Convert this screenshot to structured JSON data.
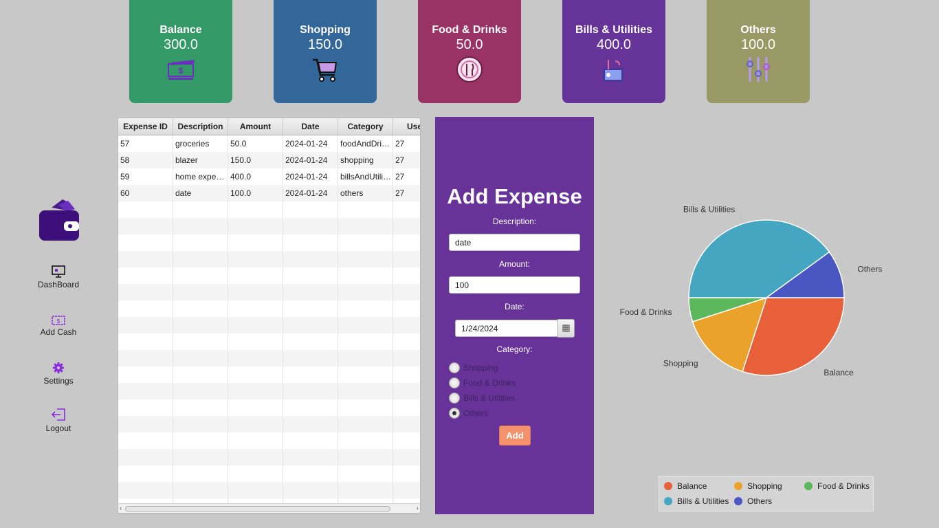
{
  "cards": [
    {
      "title": "Balance",
      "value": "300.0",
      "color": "#339966",
      "icon": "cash-icon"
    },
    {
      "title": "Shopping",
      "value": "150.0",
      "color": "#336699",
      "icon": "shopping-cart-icon"
    },
    {
      "title": "Food & Drinks",
      "value": "50.0",
      "color": "#993366",
      "icon": "plate-cutlery-icon"
    },
    {
      "title": "Bills & Utilities",
      "value": "400.0",
      "color": "#663399",
      "icon": "utilities-icon"
    },
    {
      "title": "Others",
      "value": "100.0",
      "color": "#999966",
      "icon": "sliders-icon"
    }
  ],
  "sidebar": {
    "items": [
      {
        "label": "DashBoard",
        "icon": "dashboard-monitor-icon"
      },
      {
        "label": "Add Cash",
        "icon": "wallet-cash-icon"
      },
      {
        "label": "Settings",
        "icon": "gear-icon"
      },
      {
        "label": "Logout",
        "icon": "logout-icon"
      }
    ]
  },
  "table": {
    "headers": [
      "Expense ID",
      "Description",
      "Amount",
      "Date",
      "Category",
      "User"
    ],
    "rows": [
      [
        "57",
        "groceries",
        "50.0",
        "2024-01-24",
        "foodAndDrinks",
        "27"
      ],
      [
        "58",
        "blazer",
        "150.0",
        "2024-01-24",
        "shopping",
        "27"
      ],
      [
        "59",
        "home expenses",
        "400.0",
        "2024-01-24",
        "billsAndUtilities",
        "27"
      ],
      [
        "60",
        "date",
        "100.0",
        "2024-01-24",
        "others",
        "27"
      ]
    ]
  },
  "form": {
    "title": "Add Expense",
    "description_label": "Description:",
    "description_value": "date",
    "amount_label": "Amount:",
    "amount_value": "100",
    "date_label": "Date:",
    "date_value": "1/24/2024",
    "category_label": "Category:",
    "categories": [
      {
        "label": "Shopping",
        "selected": false
      },
      {
        "label": "Food & Drinks",
        "selected": false
      },
      {
        "label": "Bills & Utilities",
        "selected": false
      },
      {
        "label": "Others",
        "selected": true
      }
    ],
    "add_label": "Add"
  },
  "chart_data": {
    "type": "pie",
    "categories": [
      "Balance",
      "Shopping",
      "Food & Drinks",
      "Bills & Utilities",
      "Others"
    ],
    "values": [
      300,
      150,
      50,
      400,
      100
    ],
    "colors": [
      "#e8603a",
      "#eba22a",
      "#5cb85c",
      "#45a6c2",
      "#4a56c2"
    ],
    "legend_position": "bottom-right"
  }
}
